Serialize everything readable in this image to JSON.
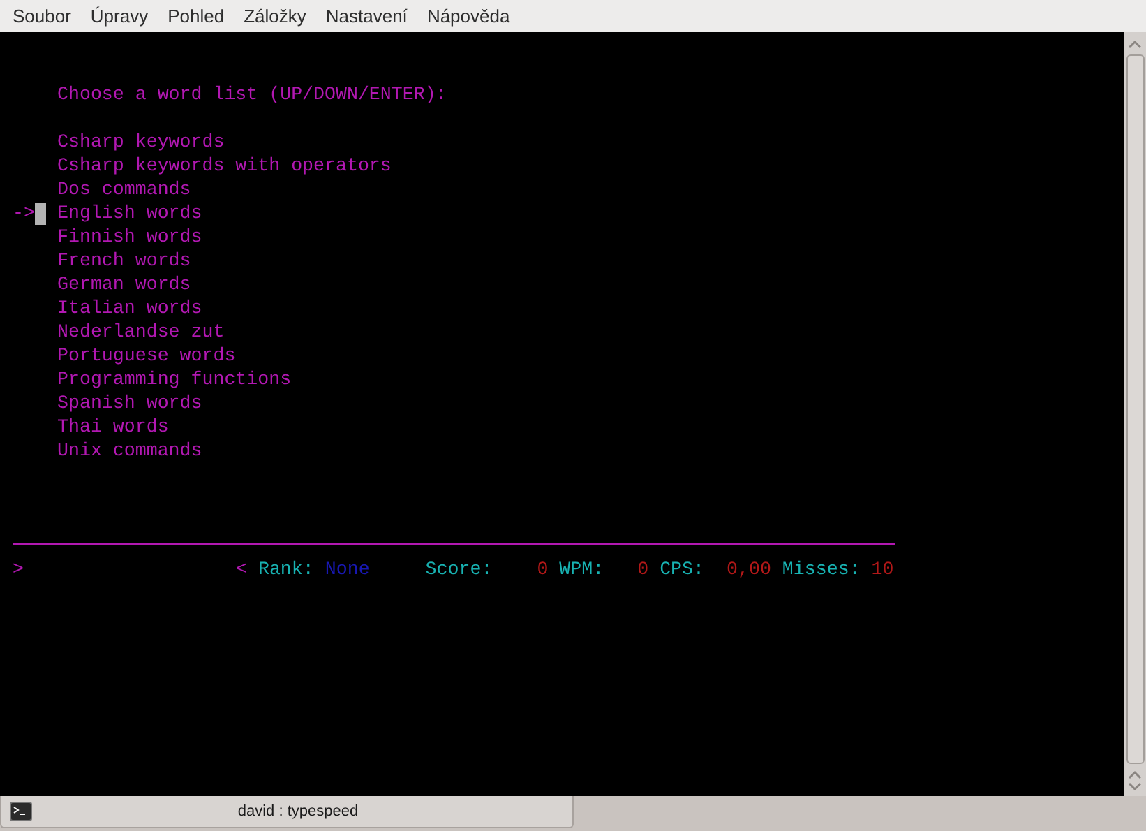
{
  "menu_bar": [
    "Soubor",
    "Úpravy",
    "Pohled",
    "Záložky",
    "Nastavení",
    "Nápověda"
  ],
  "terminal": {
    "heading": "Choose a word list (UP/DOWN/ENTER):",
    "pointer": "->",
    "word_lists": [
      {
        "label": "Csharp keywords",
        "selected": false
      },
      {
        "label": "Csharp keywords with operators",
        "selected": false
      },
      {
        "label": "Dos commands",
        "selected": false
      },
      {
        "label": "English words",
        "selected": true
      },
      {
        "label": "Finnish words",
        "selected": false
      },
      {
        "label": "French words",
        "selected": false
      },
      {
        "label": "German words",
        "selected": false
      },
      {
        "label": "Italian words",
        "selected": false
      },
      {
        "label": "Nederlandse zut",
        "selected": false
      },
      {
        "label": "Portuguese words",
        "selected": false
      },
      {
        "label": "Programming functions",
        "selected": false
      },
      {
        "label": "Spanish words",
        "selected": false
      },
      {
        "label": "Thai words",
        "selected": false
      },
      {
        "label": "Unix commands",
        "selected": false
      }
    ],
    "status_line": {
      "prompt": ">",
      "marker": "<",
      "rank_label": "Rank:",
      "rank": "None",
      "score_label": "Score:",
      "score": "0",
      "wpm_label": "WPM:",
      "wpm": "0",
      "cps_label": "CPS:",
      "cps": "0,00",
      "misses_label": "Misses:",
      "misses": "10"
    }
  },
  "tab_bar": {
    "tabs": [
      {
        "label": "david : typespeed",
        "selected": true
      }
    ]
  }
}
